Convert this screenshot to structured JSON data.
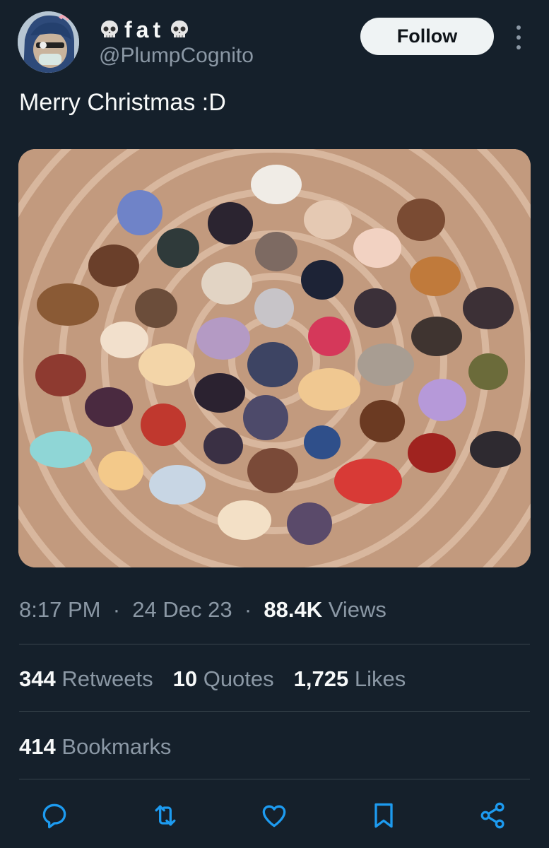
{
  "user": {
    "display_name": "fat",
    "handle": "@PlumpCognito",
    "follow_label": "Follow"
  },
  "tweet": {
    "text": "Merry Christmas :D",
    "time": "8:17 PM",
    "date": "24 Dec 23",
    "views_count": "88.4K",
    "views_label": "Views"
  },
  "stats": {
    "retweets_count": "344",
    "retweets_label": "Retweets",
    "quotes_count": "10",
    "quotes_label": "Quotes",
    "likes_count": "1,725",
    "likes_label": "Likes",
    "bookmarks_count": "414",
    "bookmarks_label": "Bookmarks"
  },
  "icons": {
    "name_decoration": "skull-icon",
    "actions": [
      "reply-icon",
      "retweet-icon",
      "like-icon",
      "bookmark-icon",
      "share-icon"
    ]
  },
  "colors": {
    "background": "#15202b",
    "text_primary": "#f7f9f9",
    "text_secondary": "#8b98a5",
    "divider": "#38444d",
    "follow_button_bg": "#eff3f4"
  }
}
